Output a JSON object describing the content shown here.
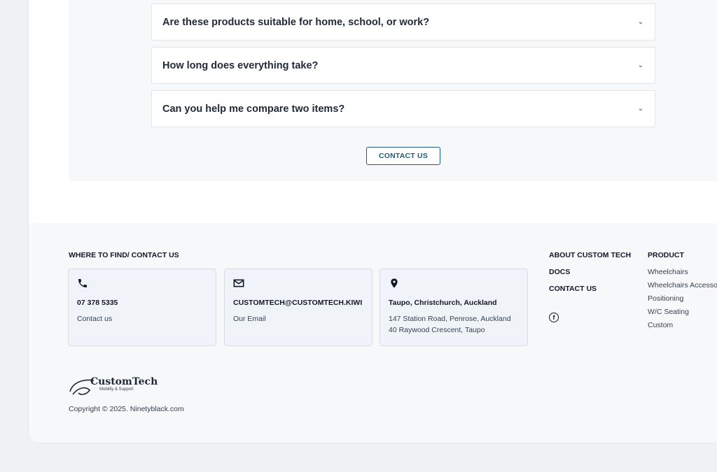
{
  "faq": {
    "items": [
      {
        "question": "Are these products suitable for home, school, or work?"
      },
      {
        "question": "How long does everything take?"
      },
      {
        "question": "Can you help me compare two items?"
      }
    ],
    "chevron": "⌄",
    "contact_button": "CONTACT US"
  },
  "footer": {
    "where_title": "WHERE TO FIND/ CONTACT US",
    "contacts": [
      {
        "icon": "phone-icon",
        "main": "07 378 5335",
        "sub1": "Contact us",
        "sub2": ""
      },
      {
        "icon": "mail-icon",
        "main": "CUSTOMTECH@CUSTOMTECH.KIWI",
        "sub1": "Our Email",
        "sub2": ""
      },
      {
        "icon": "location-pin-icon",
        "main": "Taupo, Christchurch, Auckland",
        "sub1": "147 Station Road, Penrose, Auckland",
        "sub2": "40 Raywood Crescent, Taupo"
      }
    ],
    "nav": {
      "about": "ABOUT CUSTOM TECH",
      "docs": "DOCS",
      "contact": "CONTACT US",
      "social_icon": "facebook-icon"
    },
    "product": {
      "title": "PRODUCT",
      "links": [
        "Wheelchairs",
        "Wheelchairs Accessories",
        "Positioning",
        "W/C Seating",
        "Custom"
      ]
    },
    "logo": {
      "name": "CustomTech",
      "tagline": "Mobility & Support"
    },
    "copyright": "Copyright © 2025. Ninetyblack.com"
  }
}
